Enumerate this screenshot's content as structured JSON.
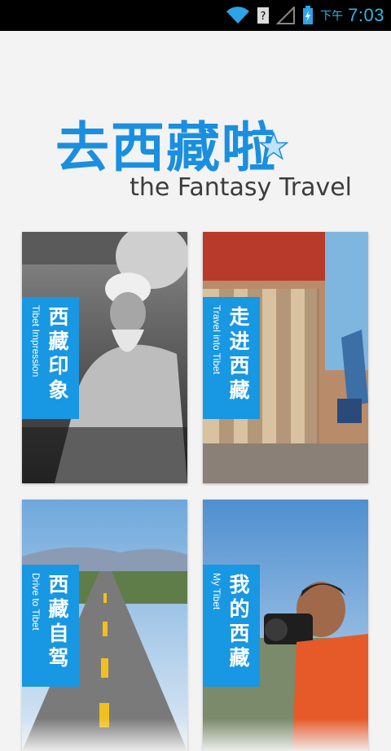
{
  "status_bar": {
    "ampm": "下午",
    "time": "7:03",
    "icons": [
      "wifi-icon",
      "unknown-sim-icon",
      "signal-icon",
      "battery-charging-icon"
    ]
  },
  "logo": {
    "title_cn": "去西藏啦",
    "subtitle_en": "the Fantasy Travel"
  },
  "tiles": [
    {
      "label_cn": "西藏印象",
      "label_en": "Tibet Impression"
    },
    {
      "label_cn": "走进西藏",
      "label_en": "Travel into Tibet"
    },
    {
      "label_cn": "西藏自驾",
      "label_en": "Drive to Tibet"
    },
    {
      "label_cn": "我的西藏",
      "label_en": "My Tibet"
    }
  ],
  "colors": {
    "accent": "#1897e3",
    "status_text": "#33b5e5",
    "background": "#f3f3f3"
  }
}
